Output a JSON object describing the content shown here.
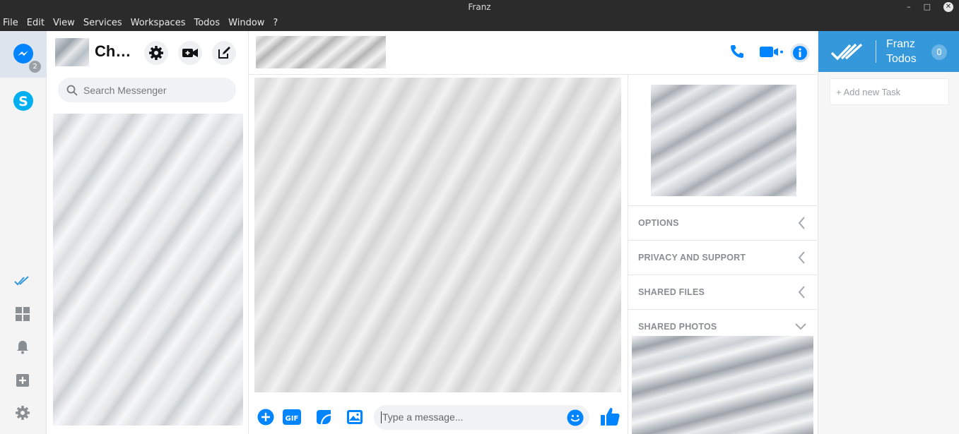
{
  "window": {
    "title": "Franz"
  },
  "menu": [
    "File",
    "Edit",
    "View",
    "Services",
    "Workspaces",
    "Todos",
    "Window",
    "?"
  ],
  "services": {
    "messenger_badge": "2"
  },
  "conversations": {
    "title": "Ch…",
    "search_placeholder": "Search Messenger"
  },
  "composer": {
    "placeholder": "Type a message...",
    "gif_label": "GIF"
  },
  "info_panel": {
    "options": "OPTIONS",
    "privacy": "PRIVACY AND SUPPORT",
    "shared_files": "SHARED FILES",
    "shared_photos": "SHARED PHOTOS"
  },
  "todos": {
    "title_line1": "Franz",
    "title_line2": "Todos",
    "count": "0",
    "add_placeholder": "+ Add new Task"
  },
  "colors": {
    "accent": "#3498db",
    "messenger": "#0084ff",
    "skype": "#00aff0"
  }
}
